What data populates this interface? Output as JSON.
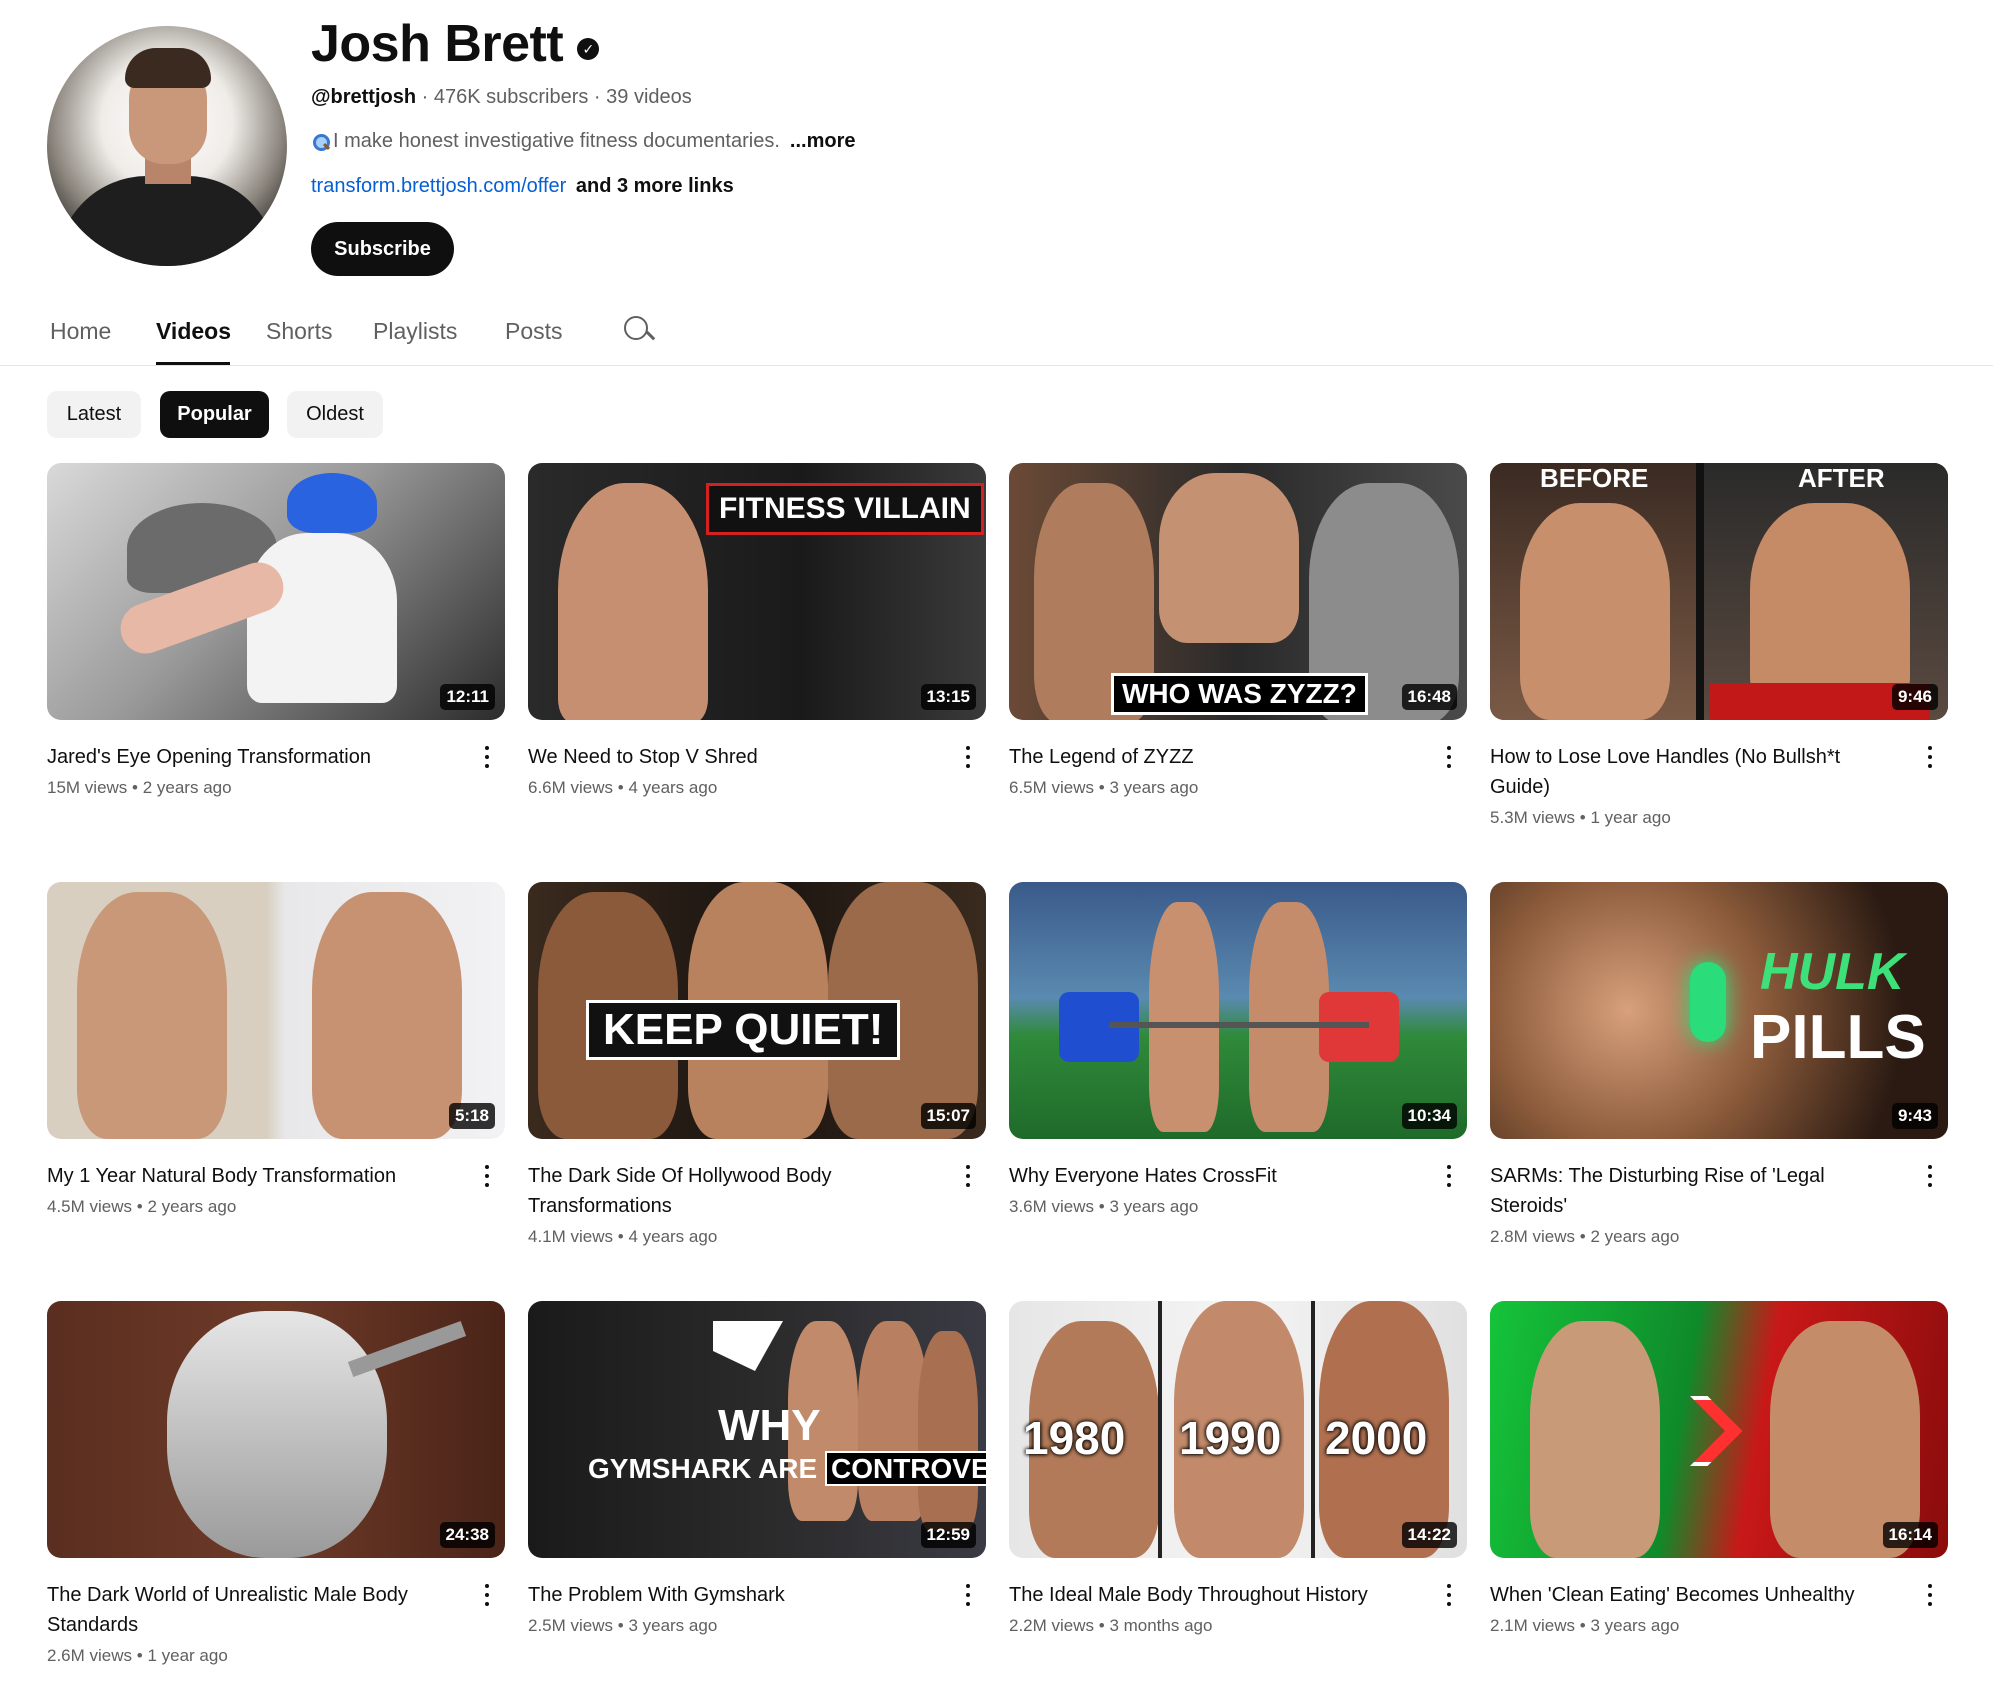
{
  "channel": {
    "name": "Josh Brett",
    "verified_icon": "verified-check-icon",
    "handle": "@brettjosh",
    "subscribers": "476K subscribers",
    "video_count": "39 videos",
    "separator": " · ",
    "description": "I make honest investigative fitness documentaries.",
    "more_label": "...more",
    "link": "transform.brettjosh.com/offer",
    "more_links": "and 3 more links",
    "subscribe_label": "Subscribe"
  },
  "tabs": [
    {
      "label": "Home"
    },
    {
      "label": "Videos",
      "active": true
    },
    {
      "label": "Shorts"
    },
    {
      "label": "Playlists"
    },
    {
      "label": "Posts"
    }
  ],
  "filters": [
    {
      "label": "Latest"
    },
    {
      "label": "Popular",
      "selected": true
    },
    {
      "label": "Oldest"
    }
  ],
  "videos": [
    {
      "title": "Jared's Eye Opening Transformation",
      "views": "15M views",
      "age": "2 years ago",
      "duration": "12:11"
    },
    {
      "title": "We Need to Stop V Shred",
      "views": "6.6M views",
      "age": "4 years ago",
      "duration": "13:15",
      "overlay": "FITNESS VILLAIN"
    },
    {
      "title": "The Legend of ZYZZ",
      "views": "6.5M views",
      "age": "3 years ago",
      "duration": "16:48",
      "overlay": "WHO WAS ZYZZ?"
    },
    {
      "title": "How to Lose Love Handles (No Bullsh*t Guide)",
      "views": "5.3M views",
      "age": "1 year ago",
      "duration": "9:46",
      "overlay_left": "BEFORE",
      "overlay_right": "AFTER"
    },
    {
      "title": "My 1 Year Natural Body Transformation",
      "views": "4.5M views",
      "age": "2 years ago",
      "duration": "5:18"
    },
    {
      "title": "The Dark Side Of Hollywood Body Transformations",
      "views": "4.1M views",
      "age": "4 years ago",
      "duration": "15:07",
      "overlay": "KEEP QUIET!"
    },
    {
      "title": "Why Everyone Hates CrossFit",
      "views": "3.6M views",
      "age": "3 years ago",
      "duration": "10:34"
    },
    {
      "title": "SARMs: The Disturbing Rise of 'Legal Steroids'",
      "views": "2.8M views",
      "age": "2 years ago",
      "duration": "9:43",
      "overlay_top": "HULK",
      "overlay_bottom": "PILLS"
    },
    {
      "title": "The Dark World of Unrealistic Male Body Standards",
      "views": "2.6M views",
      "age": "1 year ago",
      "duration": "24:38"
    },
    {
      "title": "The Problem With Gymshark",
      "views": "2.5M views",
      "age": "3 years ago",
      "duration": "12:59",
      "overlay_top": "WHY",
      "overlay_bottom_a": "GYMSHARK ARE",
      "overlay_bottom_b": "CONTROVERSIAL"
    },
    {
      "title": "The Ideal Male Body Throughout History",
      "views": "2.2M views",
      "age": "3 months ago",
      "duration": "14:22",
      "years": [
        "1980",
        "1990",
        "2000"
      ]
    },
    {
      "title": "When 'Clean Eating' Becomes Unhealthy",
      "views": "2.1M views",
      "age": "3 years ago",
      "duration": "16:14"
    }
  ],
  "colors": {
    "link": "#065fd4",
    "text_primary": "#0f0f0f",
    "text_secondary": "#606060",
    "chip_bg": "#f2f2f2"
  }
}
